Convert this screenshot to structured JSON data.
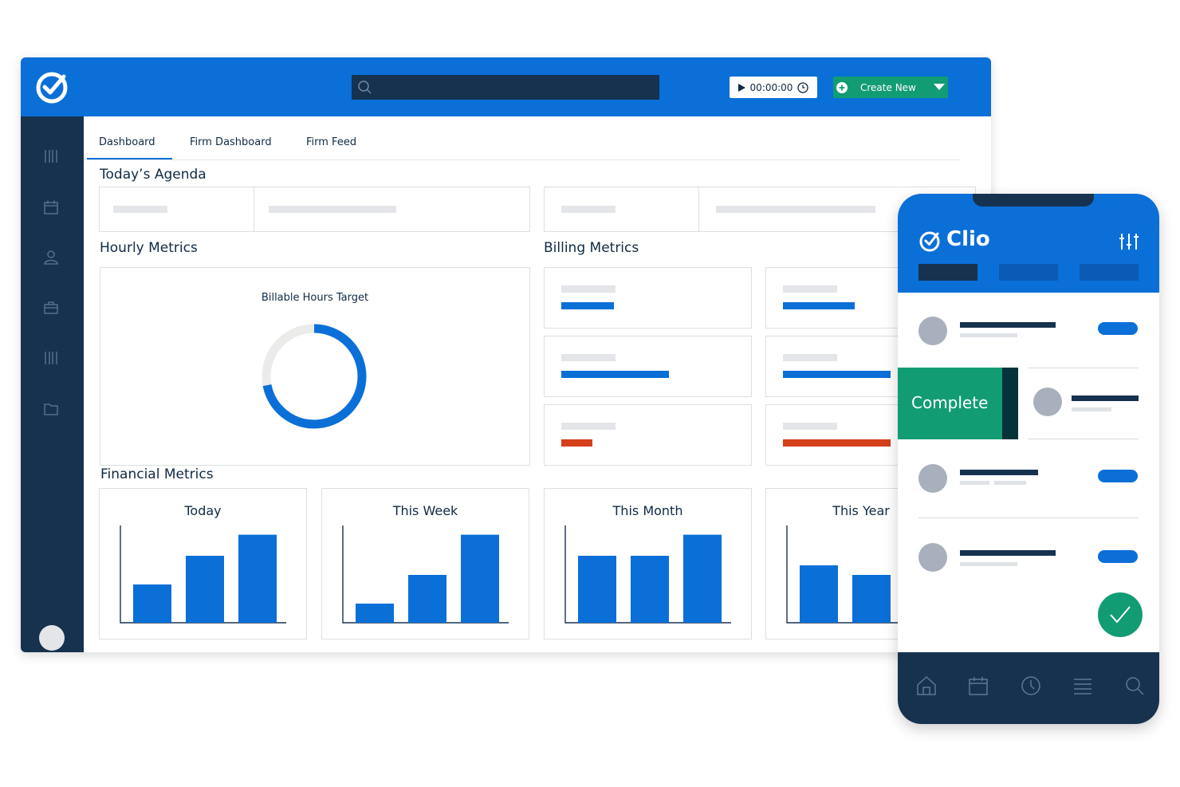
{
  "app": {
    "timer": "00:00:00",
    "create_new": "Create New"
  },
  "tabs": [
    {
      "label": "Dashboard",
      "active": true
    },
    {
      "label": "Firm Dashboard",
      "active": false
    },
    {
      "label": "Firm Feed",
      "active": false
    }
  ],
  "sections": {
    "agenda": "Today’s Agenda",
    "hourly": "Hourly Metrics",
    "billing": "Billing Metrics",
    "financial": "Financial Metrics"
  },
  "hourly": {
    "donut_title": "Billable Hours Target",
    "donut_fraction": 0.72
  },
  "billing": {
    "fractions_left": [
      0.49,
      1.0,
      0.29
    ],
    "fractions_right": [
      0.67,
      1.0,
      1.0
    ],
    "colors": [
      "#0b6fd8",
      "#0b6fd8",
      "#d4401a"
    ]
  },
  "chart_data": [
    {
      "type": "bar",
      "title": "Today",
      "values": [
        4,
        7,
        9.2
      ],
      "ylim": [
        0,
        10
      ]
    },
    {
      "type": "bar",
      "title": "This Week",
      "values": [
        2,
        5,
        9.2
      ],
      "ylim": [
        0,
        10
      ]
    },
    {
      "type": "bar",
      "title": "This Month",
      "values": [
        7,
        7,
        9.2
      ],
      "ylim": [
        0,
        10
      ]
    },
    {
      "type": "bar",
      "title": "This Year",
      "values": [
        6,
        5
      ],
      "ylim": [
        0,
        10
      ]
    }
  ],
  "phone": {
    "brand": "Clio",
    "complete_label": "Complete"
  },
  "colors": {
    "brand_blue": "#0b6fd8",
    "navy": "#16324f",
    "green": "#129c74",
    "red": "#d4401a"
  }
}
